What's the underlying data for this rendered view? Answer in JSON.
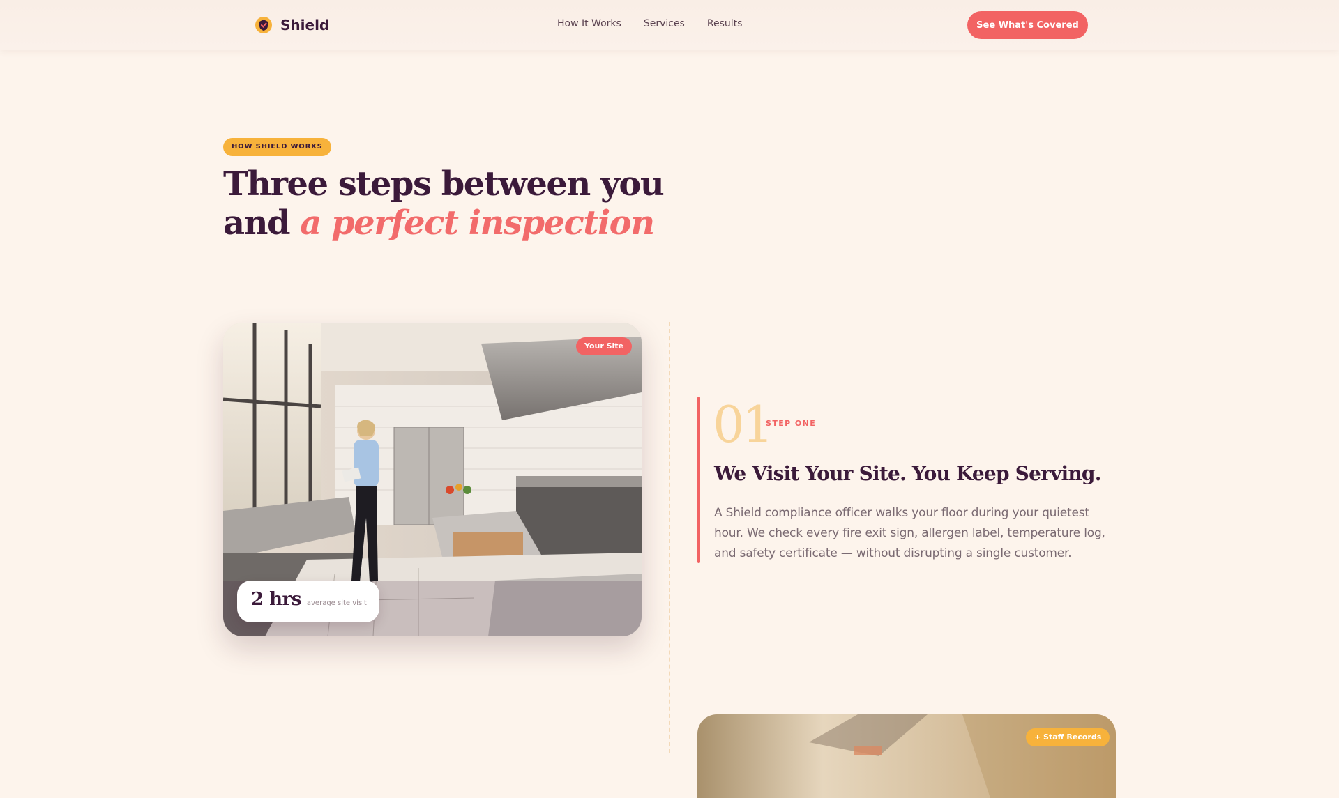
{
  "nav": {
    "brand": "Shield",
    "links": [
      "How It Works",
      "Services",
      "Results"
    ],
    "cta": "See What's Covered"
  },
  "hero": {
    "eyebrow": "HOW SHIELD WORKS",
    "headline_main": "Three steps between you and ",
    "headline_accent": "a perfect inspection"
  },
  "step1": {
    "number": "01",
    "kicker": "STEP ONE",
    "title": "We Visit Your Site. You Keep Serving.",
    "body": "A Shield compliance officer walks your floor during your quietest hour. We check every fire exit sign, allergen label, temperature log, and safety certificate — without disrupting a single customer.",
    "image_badge": "Your Site",
    "stat_value": "2 hrs",
    "stat_label": "average site visit"
  },
  "step2": {
    "image_badge": "+ Staff Records"
  },
  "colors": {
    "background": "#fdf4ec",
    "primary": "#f26363",
    "amber": "#f7b23b",
    "ink": "#3b1a3a"
  },
  "icons": {
    "brand_logo": "shield-icon"
  }
}
